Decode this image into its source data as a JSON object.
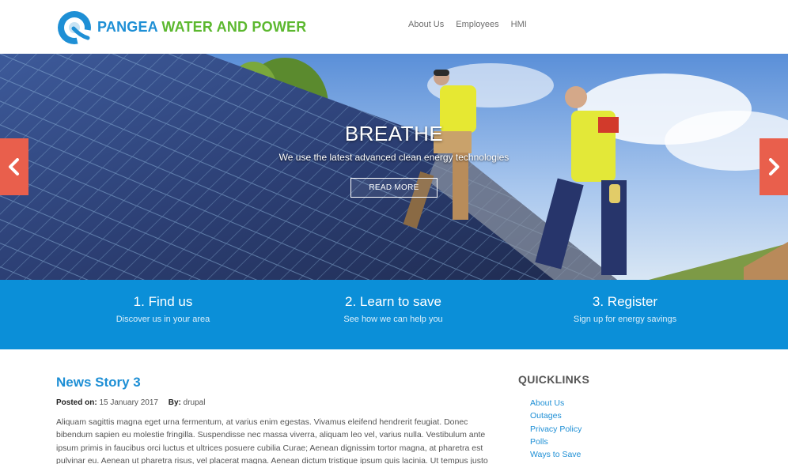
{
  "brand": {
    "name_part1": "PANGEA",
    "name_part2": "WATER AND POWER",
    "icon": "pangea-logo-icon",
    "color_primary": "#1e8fd5",
    "color_secondary": "#5cb82f"
  },
  "nav": {
    "items": [
      "About Us",
      "Employees",
      "HMI"
    ]
  },
  "hero": {
    "title": "BREATHE",
    "subtitle": "We use the latest advanced clean energy technologies",
    "button_label": "READ MORE",
    "prev_icon": "chevron-left-icon",
    "next_icon": "chevron-right-icon",
    "arrow_color": "#e95f4c"
  },
  "features": {
    "band_color": "#0b8fd8",
    "items": [
      {
        "title": "1. Find us",
        "subtitle": "Discover us in your area"
      },
      {
        "title": "2. Learn to save",
        "subtitle": "See how we can help you"
      },
      {
        "title": "3. Register",
        "subtitle": "Sign up for energy savings"
      }
    ]
  },
  "story": {
    "title": "News Story 3",
    "posted_label": "Posted on:",
    "posted_date": "15 January 2017",
    "by_label": "By:",
    "author": "drupal",
    "body": "Aliquam sagittis magna eget urna fermentum, at varius enim egestas. Vivamus eleifend hendrerit feugiat. Donec bibendum sapien eu molestie fringilla. Suspendisse nec massa viverra, aliquam leo vel, varius nulla. Vestibulum ante ipsum primis in faucibus orci luctus et ultrices posuere cubilia Curae; Aenean dignissim tortor magna, at pharetra est pulvinar eu. Aenean ut pharetra risus, vel placerat magna. Aenean dictum tristique ipsum quis lacinia. Ut tempus justo"
  },
  "quicklinks": {
    "title": "QUICKLINKS",
    "items": [
      "About Us",
      "Outages",
      "Privacy Policy",
      "Polls",
      "Ways to Save"
    ]
  }
}
